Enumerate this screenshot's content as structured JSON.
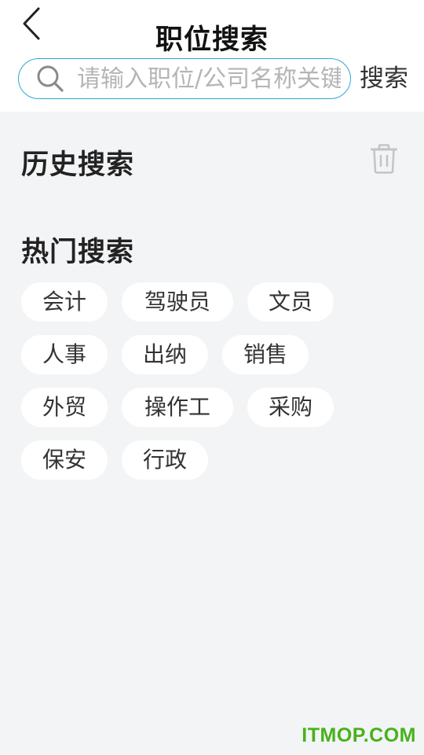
{
  "header": {
    "title": "职位搜索",
    "back_icon": "chevron-left-icon"
  },
  "search": {
    "placeholder": "请输入职位/公司名称关键字",
    "value": "",
    "button_label": "搜索",
    "border_color": "#2ea7d8"
  },
  "history": {
    "title": "历史搜索",
    "clear_icon": "trash-icon"
  },
  "hot": {
    "title": "热门搜索",
    "rows": [
      [
        "会计",
        "驾驶员",
        "文员"
      ],
      [
        "人事",
        "出纳",
        "销售"
      ],
      [
        "外贸",
        "操作工",
        "采购"
      ],
      [
        "保安",
        "行政"
      ]
    ]
  },
  "watermark": "ITMOP.COM",
  "colors": {
    "background": "#f3f4f6",
    "tag_background": "#ffffff",
    "watermark": "#46b21b"
  }
}
